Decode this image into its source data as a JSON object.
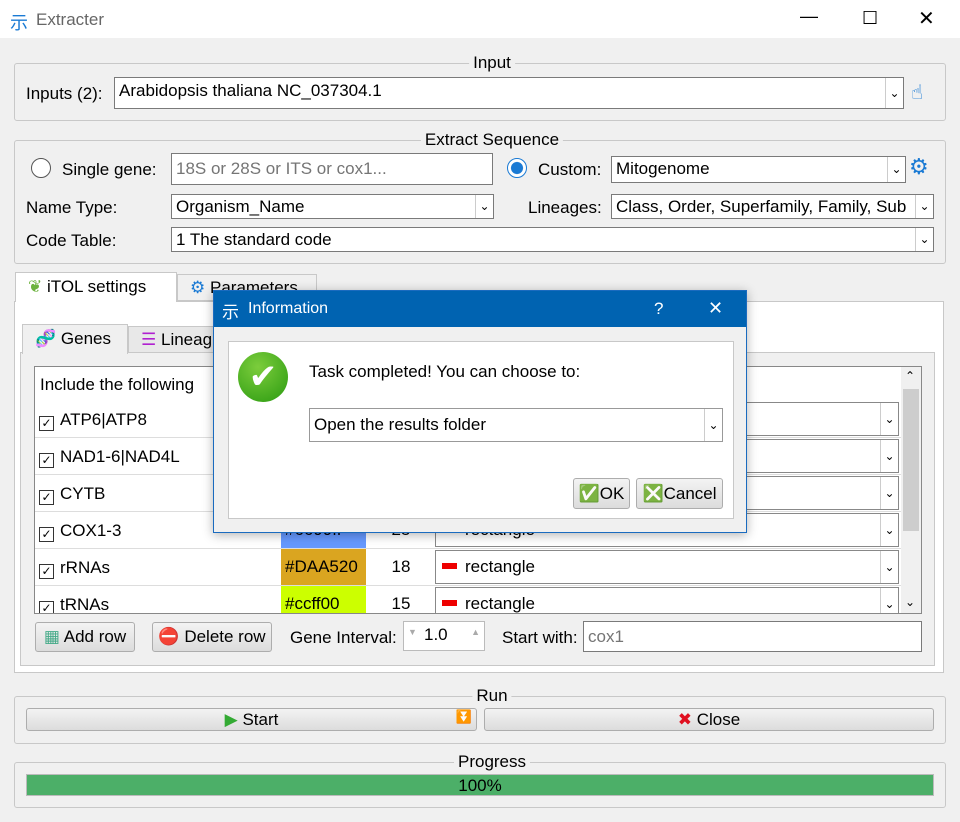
{
  "window": {
    "title": "Extracter",
    "icon": "tree-icon"
  },
  "input": {
    "group_title": "Input",
    "label": "Inputs (2):",
    "value": "Arabidopsis thaliana NC_037304.1"
  },
  "extract": {
    "group_title": "Extract Sequence",
    "single_gene_label": "Single gene:",
    "single_gene_placeholder": "18S or 28S or ITS or cox1...",
    "custom_label": "Custom:",
    "custom_value": "Mitogenome",
    "name_type_label": "Name Type:",
    "name_type_value": "Organism_Name",
    "lineages_label": "Lineages:",
    "lineages_value": "Class, Order, Superfamily, Family, Sub",
    "code_table_label": "Code Table:",
    "code_table_value": "1 The standard code"
  },
  "tabs": [
    {
      "label": "iTOL settings",
      "icon": "leaf-icon"
    },
    {
      "label": "Parameters",
      "icon": "gear-icon"
    }
  ],
  "subtabs": [
    {
      "label": "Genes",
      "icon": "dna-icon"
    },
    {
      "label": "Lineag",
      "icon": "database-icon"
    }
  ],
  "genes": {
    "header": "Include the following",
    "rows": [
      {
        "name": "ATP6|ATP8",
        "checked": true,
        "color": "",
        "size": "",
        "shape": ""
      },
      {
        "name": "NAD1-6|NAD4L",
        "checked": true,
        "color": "",
        "size": "",
        "shape": ""
      },
      {
        "name": "CYTB",
        "checked": true,
        "color": "",
        "size": "",
        "shape": ""
      },
      {
        "name": "COX1-3",
        "checked": true,
        "color": "#6699ff",
        "size": "25",
        "shape": "rectangle"
      },
      {
        "name": "rRNAs",
        "checked": true,
        "color": "#DAA520",
        "size": "18",
        "shape": "rectangle"
      },
      {
        "name": "tRNAs",
        "checked": true,
        "color": "#ccff00",
        "size": "15",
        "shape": "rectangle"
      }
    ]
  },
  "toolbar": {
    "add_row": "Add row",
    "delete_row": "Delete row",
    "gene_interval_label": "Gene Interval:",
    "gene_interval_value": "1.0",
    "start_with_label": "Start with:",
    "start_with_placeholder": "cox1"
  },
  "run": {
    "group_title": "Run",
    "start": "Start",
    "close": "Close"
  },
  "progress": {
    "group_title": "Progress",
    "value": 100,
    "text": "100%",
    "color": "#4caf68"
  },
  "dialog": {
    "title": "Information",
    "help": "?",
    "message": "Task completed! You can choose to:",
    "choice": "Open the results folder",
    "ok": "OK",
    "cancel": "Cancel"
  }
}
